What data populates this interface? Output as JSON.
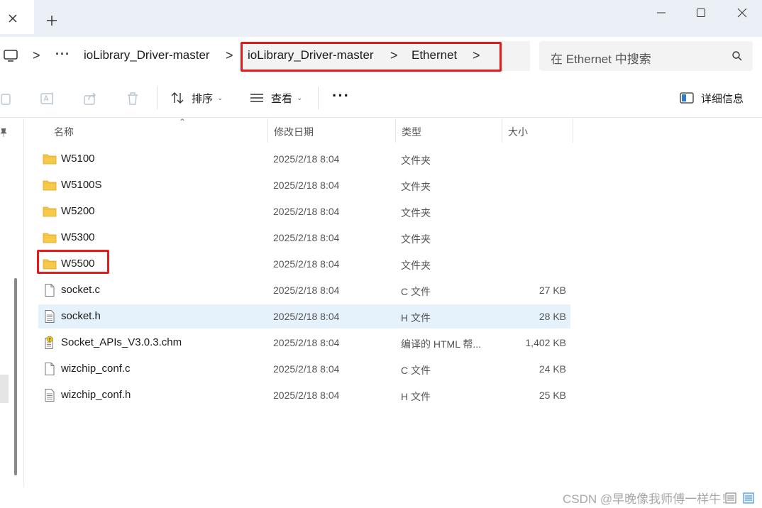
{
  "window": {
    "tab_close": "×",
    "new_tab": "+"
  },
  "address_bar": {
    "more": "···",
    "crumbs": [
      "ioLibrary_Driver-master",
      "ioLibrary_Driver-master",
      "Ethernet"
    ],
    "sep": ">"
  },
  "search": {
    "placeholder": "在 Ethernet 中搜索"
  },
  "toolbar": {
    "sort_label": "排序",
    "view_label": "查看",
    "more_label": "···",
    "details_label": "详细信息"
  },
  "columns": {
    "name": "名称",
    "modified": "修改日期",
    "type": "类型",
    "size": "大小"
  },
  "files": [
    {
      "name": "W5100",
      "date": "2025/2/18 8:04",
      "type": "文件夹",
      "size": "",
      "icon": "folder-icon"
    },
    {
      "name": "W5100S",
      "date": "2025/2/18 8:04",
      "type": "文件夹",
      "size": "",
      "icon": "folder-icon"
    },
    {
      "name": "W5200",
      "date": "2025/2/18 8:04",
      "type": "文件夹",
      "size": "",
      "icon": "folder-icon"
    },
    {
      "name": "W5300",
      "date": "2025/2/18 8:04",
      "type": "文件夹",
      "size": "",
      "icon": "folder-icon"
    },
    {
      "name": "W5500",
      "date": "2025/2/18 8:04",
      "type": "文件夹",
      "size": "",
      "icon": "folder-icon"
    },
    {
      "name": "socket.c",
      "date": "2025/2/18 8:04",
      "type": "C 文件",
      "size": "27 KB",
      "icon": "c-file-icon"
    },
    {
      "name": "socket.h",
      "date": "2025/2/18 8:04",
      "type": "H 文件",
      "size": "28 KB",
      "icon": "h-file-icon"
    },
    {
      "name": "Socket_APIs_V3.0.3.chm",
      "date": "2025/2/18 8:04",
      "type": "编译的 HTML 帮...",
      "size": "1,402 KB",
      "icon": "chm-help-icon"
    },
    {
      "name": "wizchip_conf.c",
      "date": "2025/2/18 8:04",
      "type": "C 文件",
      "size": "24 KB",
      "icon": "c-file-icon"
    },
    {
      "name": "wizchip_conf.h",
      "date": "2025/2/18 8:04",
      "type": "H 文件",
      "size": "25 KB",
      "icon": "h-file-icon"
    }
  ],
  "watermark": "CSDN @早晚像我师傅一样牛！",
  "colors": {
    "highlight_border": "#e21b1b",
    "selected_row": "#e5f1fb",
    "folder": "#f7c948"
  }
}
